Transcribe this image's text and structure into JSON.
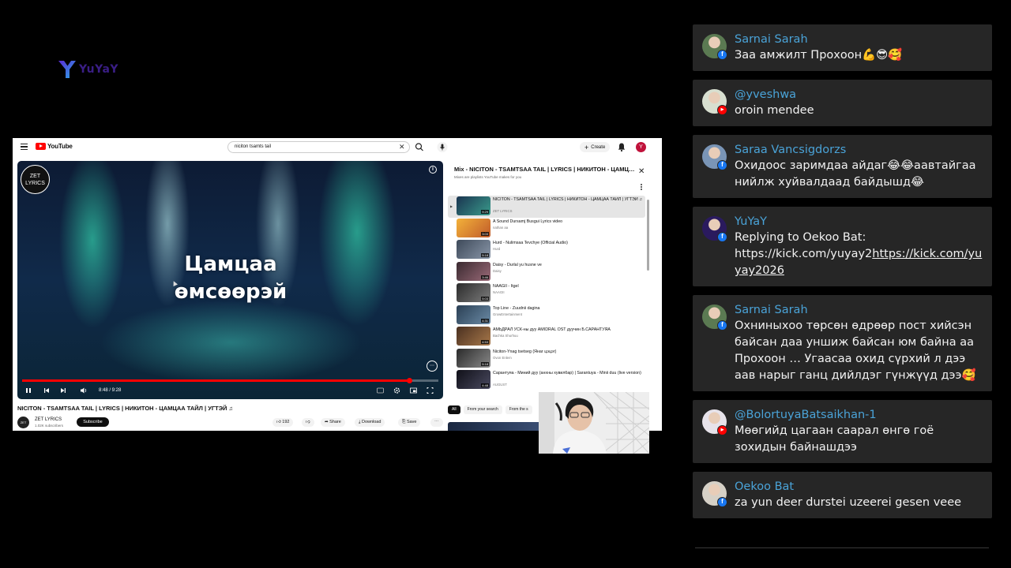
{
  "stream_logo": {
    "text": "YuYaY"
  },
  "youtube": {
    "logo_text": "YouTube",
    "search_value": "niciton tsamts tail",
    "create_label": "Create",
    "avatar_letter": "Y",
    "player": {
      "channel_badge": "ZET LYRICS",
      "lyric_line_1": "Цамцаа",
      "lyric_line_2": "өмсөөрэй",
      "time": "8:48 / 9:28",
      "progress": 0.93
    },
    "video_title": "NICITON - TSAMTSAA TAIL | LYRICS | НИКИТОН - ЦАМЦАА ТАЙЛ | УГТЭЙ ♫",
    "channel_name": "ZET LYRICS",
    "channel_subs": "1.02K subscribers",
    "subscribe_label": "Subscribe",
    "actions": {
      "likes": "192",
      "share": "Share",
      "download": "Download",
      "save": "Save"
    },
    "playlist": {
      "title": "Mix - NICITON - TSAMTSAA TAIL | LYRICS | НИКИТОН - ЦАМЦАА ТАЙЛ | УГТЭЙ ♫",
      "subtitle": "Mixes are playlists YouTube makes for you",
      "items": [
        {
          "title": "NICITON - TSAMTSAA TAIL | LYRICS | НИКИТОН - ЦАМЦАА ТАЙЛ | УГТЭЙ ♫",
          "channel": "ZET LYRICS",
          "duration": "9:29"
        },
        {
          "title": "A Sound Dursamj Busgui Lyrics video",
          "channel": "nathan aa",
          "duration": "3:03"
        },
        {
          "title": "Hurd - Nulimsaa Tevchye (Official Audio)",
          "channel": "Hurd",
          "duration": "5:18"
        },
        {
          "title": "Daisy - Durlal yu husne ve",
          "channel": "Daisy",
          "duration": "3:46"
        },
        {
          "title": "NAAGII - Itgel",
          "channel": "NAAGII",
          "duration": "5:03"
        },
        {
          "title": "Top Line - Zuudnii dagina",
          "channel": "GrowEntertainment",
          "duration": "4:31"
        },
        {
          "title": "АМЬДРАЛ УСК-ны дуу AMIDRAL OST дуучин Б.САРАНТУЯА",
          "channel": "Bachka Shurhuu",
          "duration": "4:53"
        },
        {
          "title": "Niciton-Ynag tsetseg (Янаг цэцэг)",
          "channel": "Ovon Enlem",
          "duration": "5:18"
        },
        {
          "title": "Сарантуяа - Миний дуу (анхны хувилбар) | Sarantuya - Minii duu (live version)",
          "channel": "AUGUST",
          "duration": "4:48"
        }
      ]
    },
    "chips": [
      "All",
      "From your search",
      "From the s"
    ]
  },
  "chat": [
    {
      "name": "Sarnai Sarah",
      "platform": "facebook",
      "text": "Заа амжилт Прохоон💪😎🥰",
      "avatar_color": "#5b7a52"
    },
    {
      "name": "@yveshwa",
      "platform": "youtube",
      "text": "oroin mendee",
      "avatar_color": "#d8dfd0"
    },
    {
      "name": "Saraa Vancsigdorzs",
      "platform": "facebook",
      "text": "Охидоос заримдаа айдаг😂😂аавтайгаа нийлж хуйвалдаад байдышд😂",
      "avatar_color": "#7a95b6"
    },
    {
      "name": "YuYaY",
      "platform": "facebook",
      "text_prefix": "Replying to Oekoo Bat: https://kick.com/yuyay2",
      "text_link": "https://kick.com/yuyay2026",
      "avatar_color": "#2a1a5e"
    },
    {
      "name": "Sarnai Sarah",
      "platform": "facebook",
      "text": "Охниныхоо төрсөн өдрөөр пост хийсэн байсан даа уншиж байсан юм байна аа Прохоон … Угаасаа охид сүрхий л дээ аав нарыг ганц дийлдэг гүнжүүд дээ🥰",
      "avatar_color": "#5b7a52"
    },
    {
      "name": "@BolortuyaBatsaikhan-1",
      "platform": "youtube",
      "text": "Мөөгийд цагаан саарал өнгө гоё зохидын байнашдээ",
      "avatar_color": "#e7e3ea"
    },
    {
      "name": "Oekoo Bat",
      "platform": "facebook",
      "text": "za yun deer durstei uzeerei gesen veee",
      "avatar_color": "#d6d1c7"
    }
  ],
  "colors": {
    "chat_name": "#4aa3d8",
    "chat_bg": "#262626",
    "yt_red": "#ff0000",
    "fb_blue": "#1877f2"
  }
}
